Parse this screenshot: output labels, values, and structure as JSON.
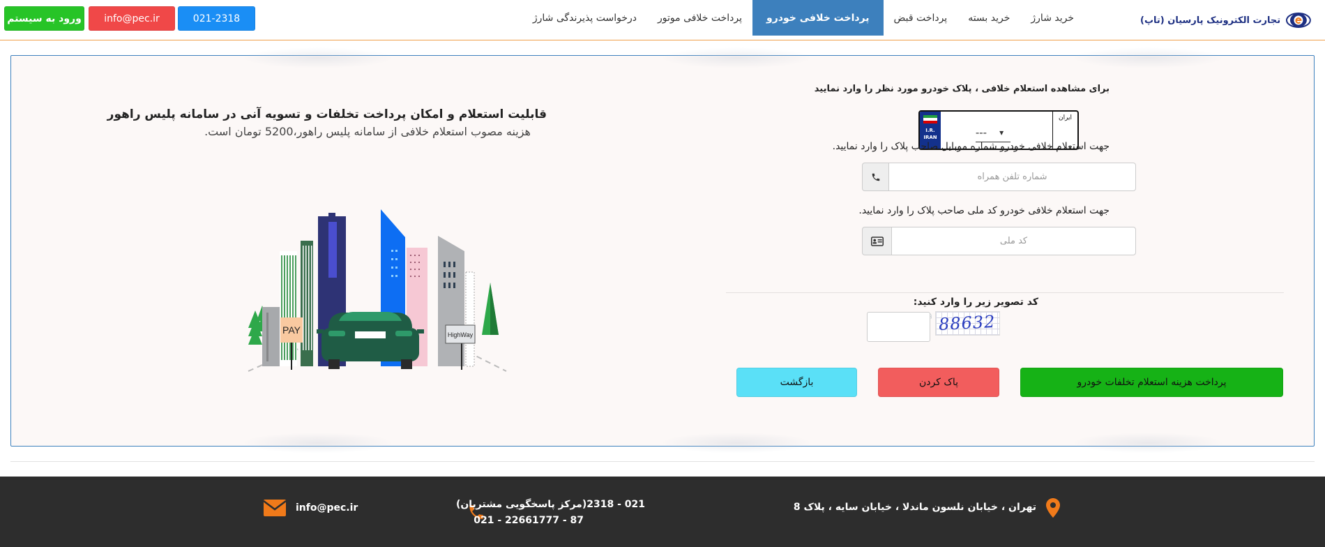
{
  "header": {
    "logo_text": "تجارت الکترونیک پارسیان (تاپ)",
    "nav": [
      {
        "label": "خرید شارژ",
        "active": false
      },
      {
        "label": "خرید بسته",
        "active": false
      },
      {
        "label": "پرداخت قبض",
        "active": false
      },
      {
        "label": "پرداخت خلافی خودرو",
        "active": true
      },
      {
        "label": "پرداخت خلافی موتور",
        "active": false
      },
      {
        "label": "درخواست پذیرندگی شارژ",
        "active": false
      }
    ],
    "phone_button": "021-2318",
    "email_button": "info@pec.ir",
    "login_button": "ورود به سیستم",
    "colors": {
      "nav_active": "#3d80bd",
      "login": "#27c427",
      "email": "#f04848",
      "phone": "#1a8ef5"
    }
  },
  "form": {
    "title": "برای مشاهده استعلام خلافی ، پلاک خودرو مورد نظر را وارد نمایید",
    "plate": {
      "select_value": "---",
      "iran_label": "ایران",
      "flag_text_1": "I.R.",
      "flag_text_2": "IRAN"
    },
    "mobile": {
      "label": "جهت استعلام خلافی خودرو شماره موبایل صاحب پلاک را وارد نمایید.",
      "placeholder": "شماره تلفن همراه",
      "icon": "phone-icon"
    },
    "national_id": {
      "label": "جهت استعلام خلافی خودرو کد ملی صاحب پلاک را وارد نمایید.",
      "placeholder": "کد ملی",
      "icon": "id-card-icon"
    },
    "captcha": {
      "label": "کد تصویر زیر را وارد کنید:",
      "image_text": "88632"
    },
    "buttons": {
      "pay": "پرداخت هزینه استعلام تخلفات خودرو",
      "clear": "پاک کردن",
      "back": "بازگشت"
    }
  },
  "info": {
    "title": "قابلیت استعلام و امکان پرداخت تخلفات و تسویه آنی در سامانه پلیس راهور",
    "subtitle": "هزینه مصوب استعلام خلافی از سامانه پلیس راهور،5200 تومان است.",
    "illustration": {
      "pay_sign": "PAY",
      "highway_sign": "HighWay"
    }
  },
  "footer": {
    "address": "تهران ، خیابان نلسون ماندلا ، خیابان سایه ، پلاک 8",
    "phone_line_1": "021 - 2318(مرکز پاسخگویی مشتریان)",
    "phone_line_2": "021 - 22661777 - 87",
    "email": "info@pec.ir",
    "icon_color": "#f07a1a"
  }
}
